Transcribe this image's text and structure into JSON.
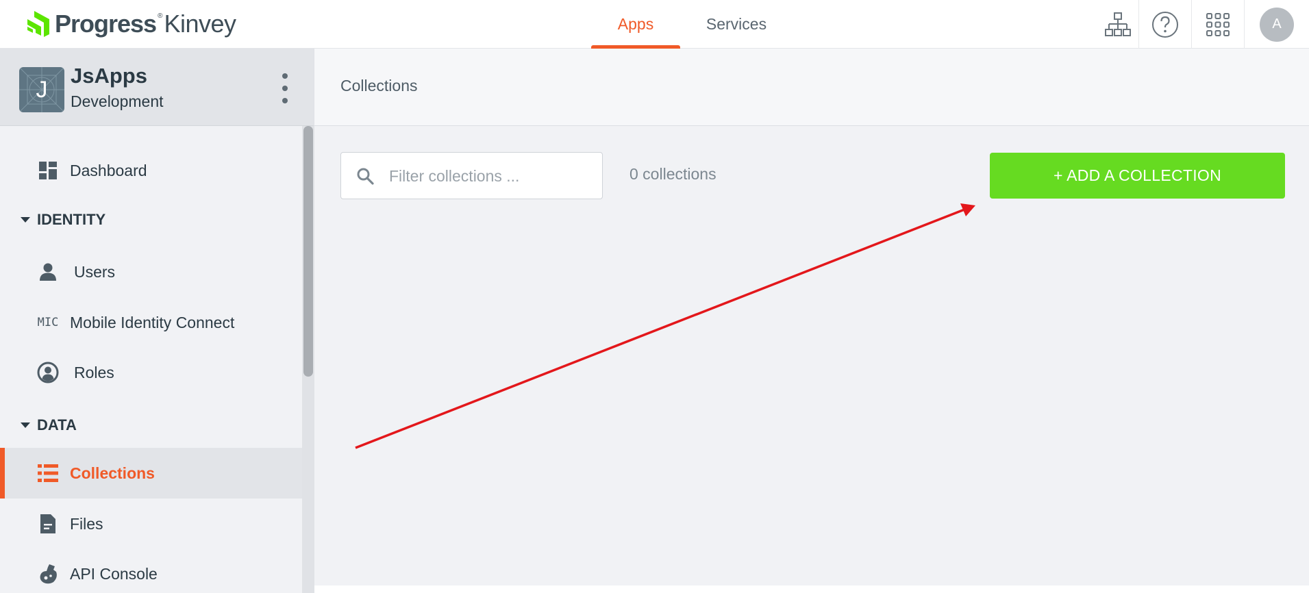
{
  "brand": {
    "name_bold": "Progress",
    "registered": "®",
    "name_light": "Kinvey",
    "logo_color": "#5ce500"
  },
  "top_nav": {
    "tabs": [
      {
        "label": "Apps",
        "active": true
      },
      {
        "label": "Services",
        "active": false
      }
    ],
    "icons": [
      "hierarchy-icon",
      "help-icon",
      "app-grid-icon"
    ],
    "user_initial": "A"
  },
  "app": {
    "initial": "J",
    "name": "JsApps",
    "environment": "Development"
  },
  "sidebar": {
    "items": [
      {
        "label": "Dashboard",
        "icon": "dashboard-icon"
      },
      {
        "section": "IDENTITY"
      },
      {
        "label": "Users",
        "icon": "user-icon"
      },
      {
        "label": "Mobile Identity Connect",
        "icon": "mic-icon",
        "icon_text": "MIC"
      },
      {
        "label": "Roles",
        "icon": "roles-icon"
      },
      {
        "section": "DATA"
      },
      {
        "label": "Collections",
        "icon": "list-icon",
        "active": true
      },
      {
        "label": "Files",
        "icon": "file-icon"
      },
      {
        "label": "API Console",
        "icon": "flask-icon"
      }
    ]
  },
  "main": {
    "title": "Collections",
    "filter_placeholder": "Filter collections ...",
    "filter_value": "",
    "count_label": "0 collections",
    "add_button_label": "+ ADD A COLLECTION"
  },
  "colors": {
    "accent": "#f05a28",
    "add_button": "#66db21",
    "annotation_arrow": "#e3171b"
  }
}
